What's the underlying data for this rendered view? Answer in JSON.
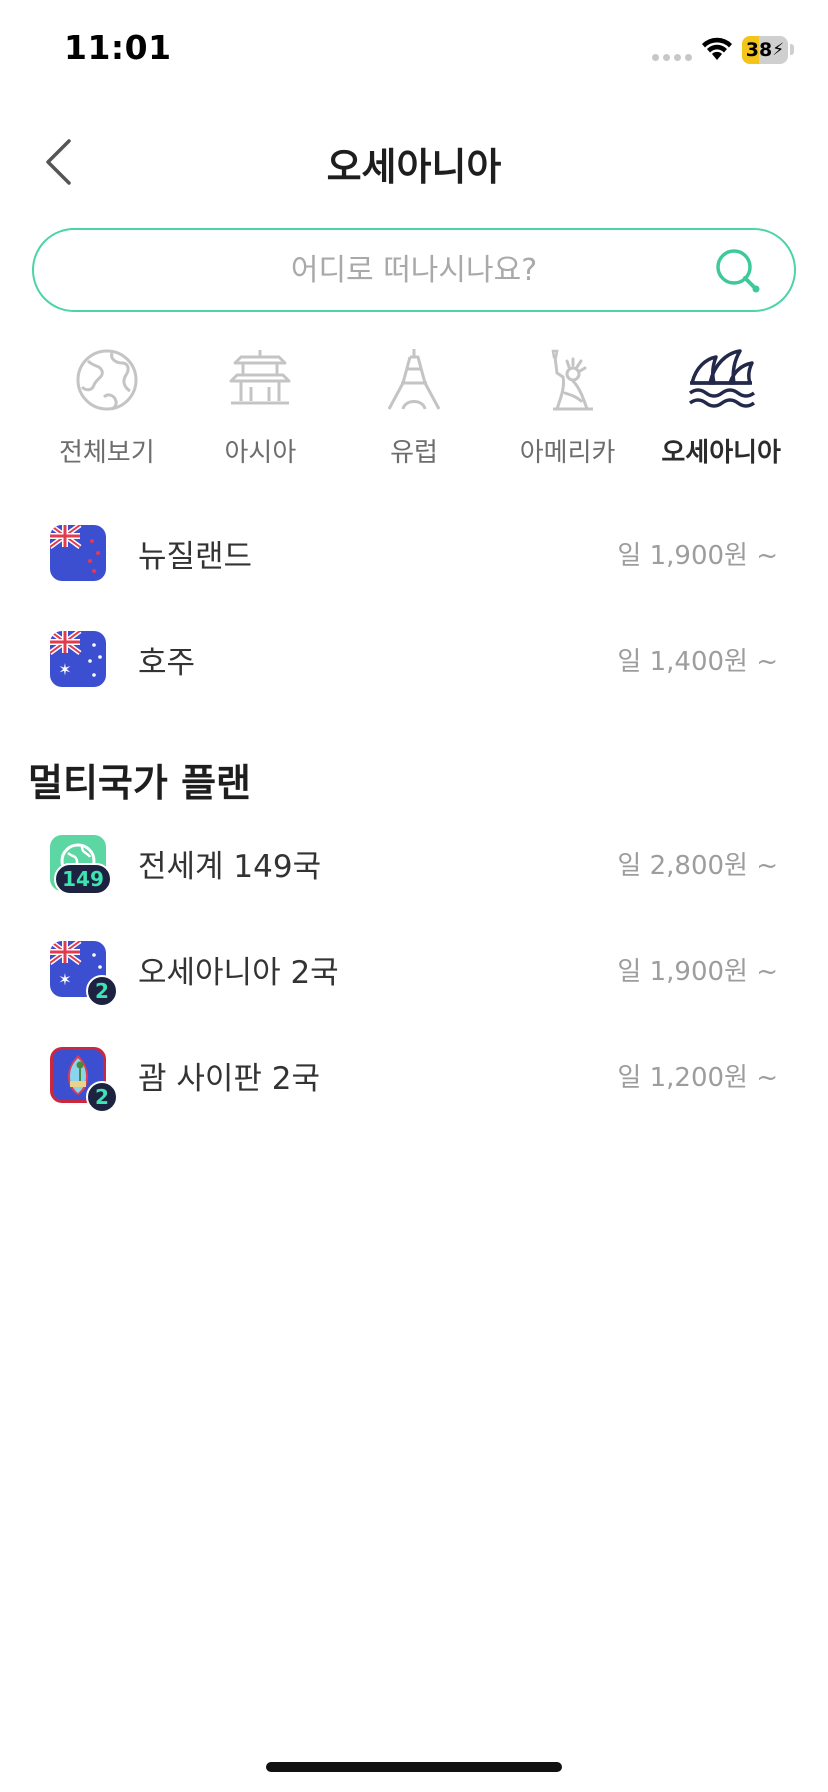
{
  "status_bar": {
    "time": "11:01",
    "battery": "38",
    "battery_level": 0.38
  },
  "header": {
    "title": "오세아니아"
  },
  "search": {
    "placeholder": "어디로 떠나시나요?"
  },
  "region_tabs": [
    {
      "label": "전체보기",
      "icon": "globe-icon",
      "active": false
    },
    {
      "label": "아시아",
      "icon": "pagoda-icon",
      "active": false
    },
    {
      "label": "유럽",
      "icon": "eiffel-tower-icon",
      "active": false
    },
    {
      "label": "아메리카",
      "icon": "statue-of-liberty-icon",
      "active": false
    },
    {
      "label": "오세아니아",
      "icon": "sydney-opera-house-icon",
      "active": true
    }
  ],
  "countries": [
    {
      "name": "뉴질랜드",
      "price": "일 1,900원 ~",
      "flag": "new-zealand-flag-icon"
    },
    {
      "name": "호주",
      "price": "일 1,400원 ~",
      "flag": "australia-flag-icon"
    }
  ],
  "multi_section": {
    "title": "멀티국가 플랜",
    "items": [
      {
        "name": "전세계 149국",
        "price": "일 2,800원 ~",
        "flag": "world-globe-icon",
        "badge": "149"
      },
      {
        "name": "오세아니아 2국",
        "price": "일 1,900원 ~",
        "flag": "australia-flag-icon",
        "badge": "2"
      },
      {
        "name": "괌 사이판 2국",
        "price": "일 1,200원 ~",
        "flag": "guam-flag-icon",
        "badge": "2"
      }
    ]
  },
  "colors": {
    "accent": "#4cd4a3",
    "badge_bg": "#1c2240",
    "badge_text": "#3ee3b4",
    "flag_blue": "#3d4fd1"
  }
}
